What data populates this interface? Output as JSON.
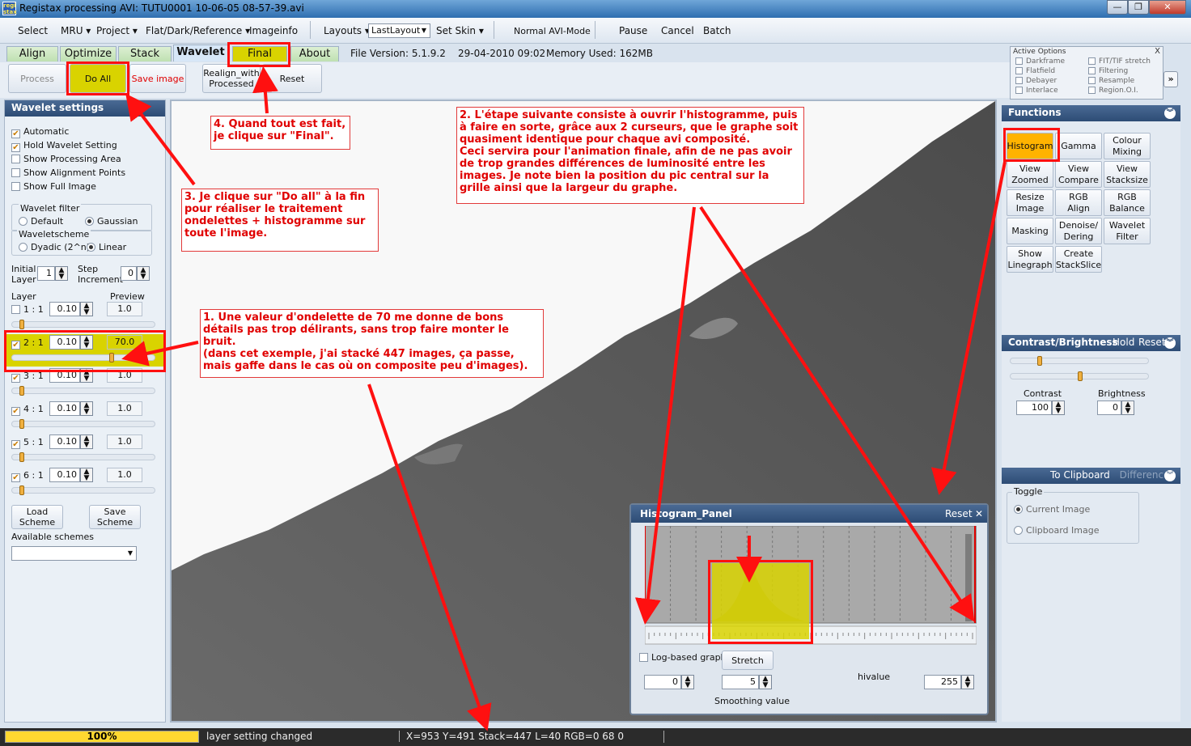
{
  "window": {
    "title": "Registax processing AVI: TUTU0001 10-06-05 08-57-39.avi",
    "app_icon": "regi stax",
    "controls": [
      "—",
      "❐",
      "✕"
    ]
  },
  "menu": {
    "items": [
      "Select",
      "MRU ▾",
      "Project ▾",
      "Flat/Dark/Reference ▾",
      "Imageinfo",
      "Layouts ▾"
    ],
    "layout_value": "LastLayout",
    "set_skin": "Set Skin ▾",
    "mode": "Normal AVI-Mode",
    "pause": "Pause",
    "cancel": "Cancel",
    "batch": "Batch"
  },
  "tabs": [
    "Align",
    "Optimize",
    "Stack",
    "Wavelet",
    "Final",
    "About"
  ],
  "info": {
    "version": "File Version: 5.1.9.2",
    "date": "29-04-2010 09:02",
    "memory": "Memory Used: 162MB"
  },
  "toolbar": {
    "process": "Process",
    "do_all": "Do All",
    "save_image": "Save image",
    "realign1": "Realign_with",
    "realign2": "Processed",
    "reset": "Reset"
  },
  "active_options": {
    "title": "Active Options",
    "left": [
      "Darkframe",
      "Flatfield",
      "Debayer",
      "Interlace"
    ],
    "right": [
      "FIT/TIF stretch",
      "Filtering",
      "Resample",
      "Region.O.I."
    ],
    "expand": "»"
  },
  "wavelet": {
    "header": "Wavelet settings",
    "checks": [
      {
        "label": "Automatic",
        "on": true
      },
      {
        "label": "Hold Wavelet Setting",
        "on": true
      },
      {
        "label": "Show Processing Area",
        "on": false
      },
      {
        "label": "Show Alignment Points",
        "on": false
      },
      {
        "label": "Show Full Image",
        "on": false
      }
    ],
    "filter_label": "Wavelet filter",
    "filter_default": "Default",
    "filter_gaussian": "Gaussian",
    "scheme_label": "Waveletscheme",
    "scheme_dyadic": "Dyadic (2^n)",
    "scheme_linear": "Linear",
    "initial_label1": "Initial",
    "initial_label2": "Layer",
    "initial_value": "1",
    "step_label1": "Step",
    "step_label2": "Increment",
    "step_value": "0",
    "layer_label": "Layer",
    "preview_label": "Preview",
    "layers": [
      {
        "name": "1 : 1",
        "value": "0.10",
        "preview": "1.0",
        "on": false,
        "level": 0.05
      },
      {
        "name": "2 : 1",
        "value": "0.10",
        "preview": "70.0",
        "on": true,
        "level": 0.7
      },
      {
        "name": "3 : 1",
        "value": "0.10",
        "preview": "1.0",
        "on": true,
        "level": 0.05
      },
      {
        "name": "4 : 1",
        "value": "0.10",
        "preview": "1.0",
        "on": true,
        "level": 0.05
      },
      {
        "name": "5 : 1",
        "value": "0.10",
        "preview": "1.0",
        "on": true,
        "level": 0.05
      },
      {
        "name": "6 : 1",
        "value": "0.10",
        "preview": "1.0",
        "on": true,
        "level": 0.05
      }
    ],
    "load1": "Load",
    "load2": "Scheme",
    "save1": "Save",
    "save2": "Scheme",
    "schemes_label": "Available schemes"
  },
  "functions": {
    "header": "Functions",
    "buttons": [
      [
        "Histogram",
        ""
      ],
      [
        "Gamma",
        ""
      ],
      [
        "Colour",
        "Mixing"
      ],
      [
        "View",
        "Zoomed"
      ],
      [
        "View",
        "Compare"
      ],
      [
        "View",
        "Stacksize"
      ],
      [
        "Resize",
        "Image"
      ],
      [
        "RGB",
        "Align"
      ],
      [
        "RGB",
        "Balance"
      ],
      [
        "Masking",
        ""
      ],
      [
        "Denoise/",
        "Dering"
      ],
      [
        "Wavelet",
        "Filter"
      ],
      [
        "Show",
        "Linegraph"
      ],
      [
        "Create",
        "StackSlice"
      ]
    ]
  },
  "contrast": {
    "header": "Contrast/Brightness",
    "hold": "Hold",
    "reset": "Reset",
    "contrast_label": "Contrast",
    "contrast_value": "100",
    "brightness_label": "Brightness",
    "brightness_value": "0",
    "contrast_level": 0.2,
    "brightness_level": 0.5
  },
  "clipboard": {
    "header": "To Clipboard",
    "difference": "Difference",
    "toggle": "Toggle",
    "current": "Current Image",
    "clip": "Clipboard Image"
  },
  "histogram": {
    "title": "Histogram_Panel",
    "reset": "Reset",
    "close": "✕",
    "log": "Log-based graph",
    "stretch": "Stretch",
    "low": "0",
    "smooth": "5",
    "hivalue_label": "hivalue",
    "hivalue": "255",
    "smoothing_label": "Smoothing value"
  },
  "status": {
    "progress": "100%",
    "message": "layer setting changed",
    "coords": "X=953 Y=491 Stack=447 L=40 RGB=0 68 0"
  },
  "annotations": {
    "a1": "1. Une valeur d'ondelette de 70 me donne de bons détails pas trop délirants, sans trop faire monter le bruit.\n(dans cet exemple, j'ai stacké 447 images, ça passe, mais gaffe dans le cas où on composite peu d'images).",
    "a2": "2. L'étape suivante consiste à ouvrir l'histogramme, puis à faire en sorte, grâce aux 2 curseurs, que le graphe soit quasiment identique pour chaque avi composité.\nCeci servira pour l'animation finale, afin de ne pas avoir de trop grandes différences de luminosité entre les images. Je note bien la position du pic central sur la grille ainsi que la largeur du graphe.",
    "a3": "3. Je clique sur \"Do all\" à la fin pour réaliser le traitement ondelettes + histogramme sur toute l'image.",
    "a4": "4. Quand tout est fait, je clique sur \"Final\"."
  },
  "colors": {
    "highlight": "#ff1010",
    "yellow": "#d9d300",
    "annotation_text": "#e00000",
    "header": "#2d4c75"
  }
}
